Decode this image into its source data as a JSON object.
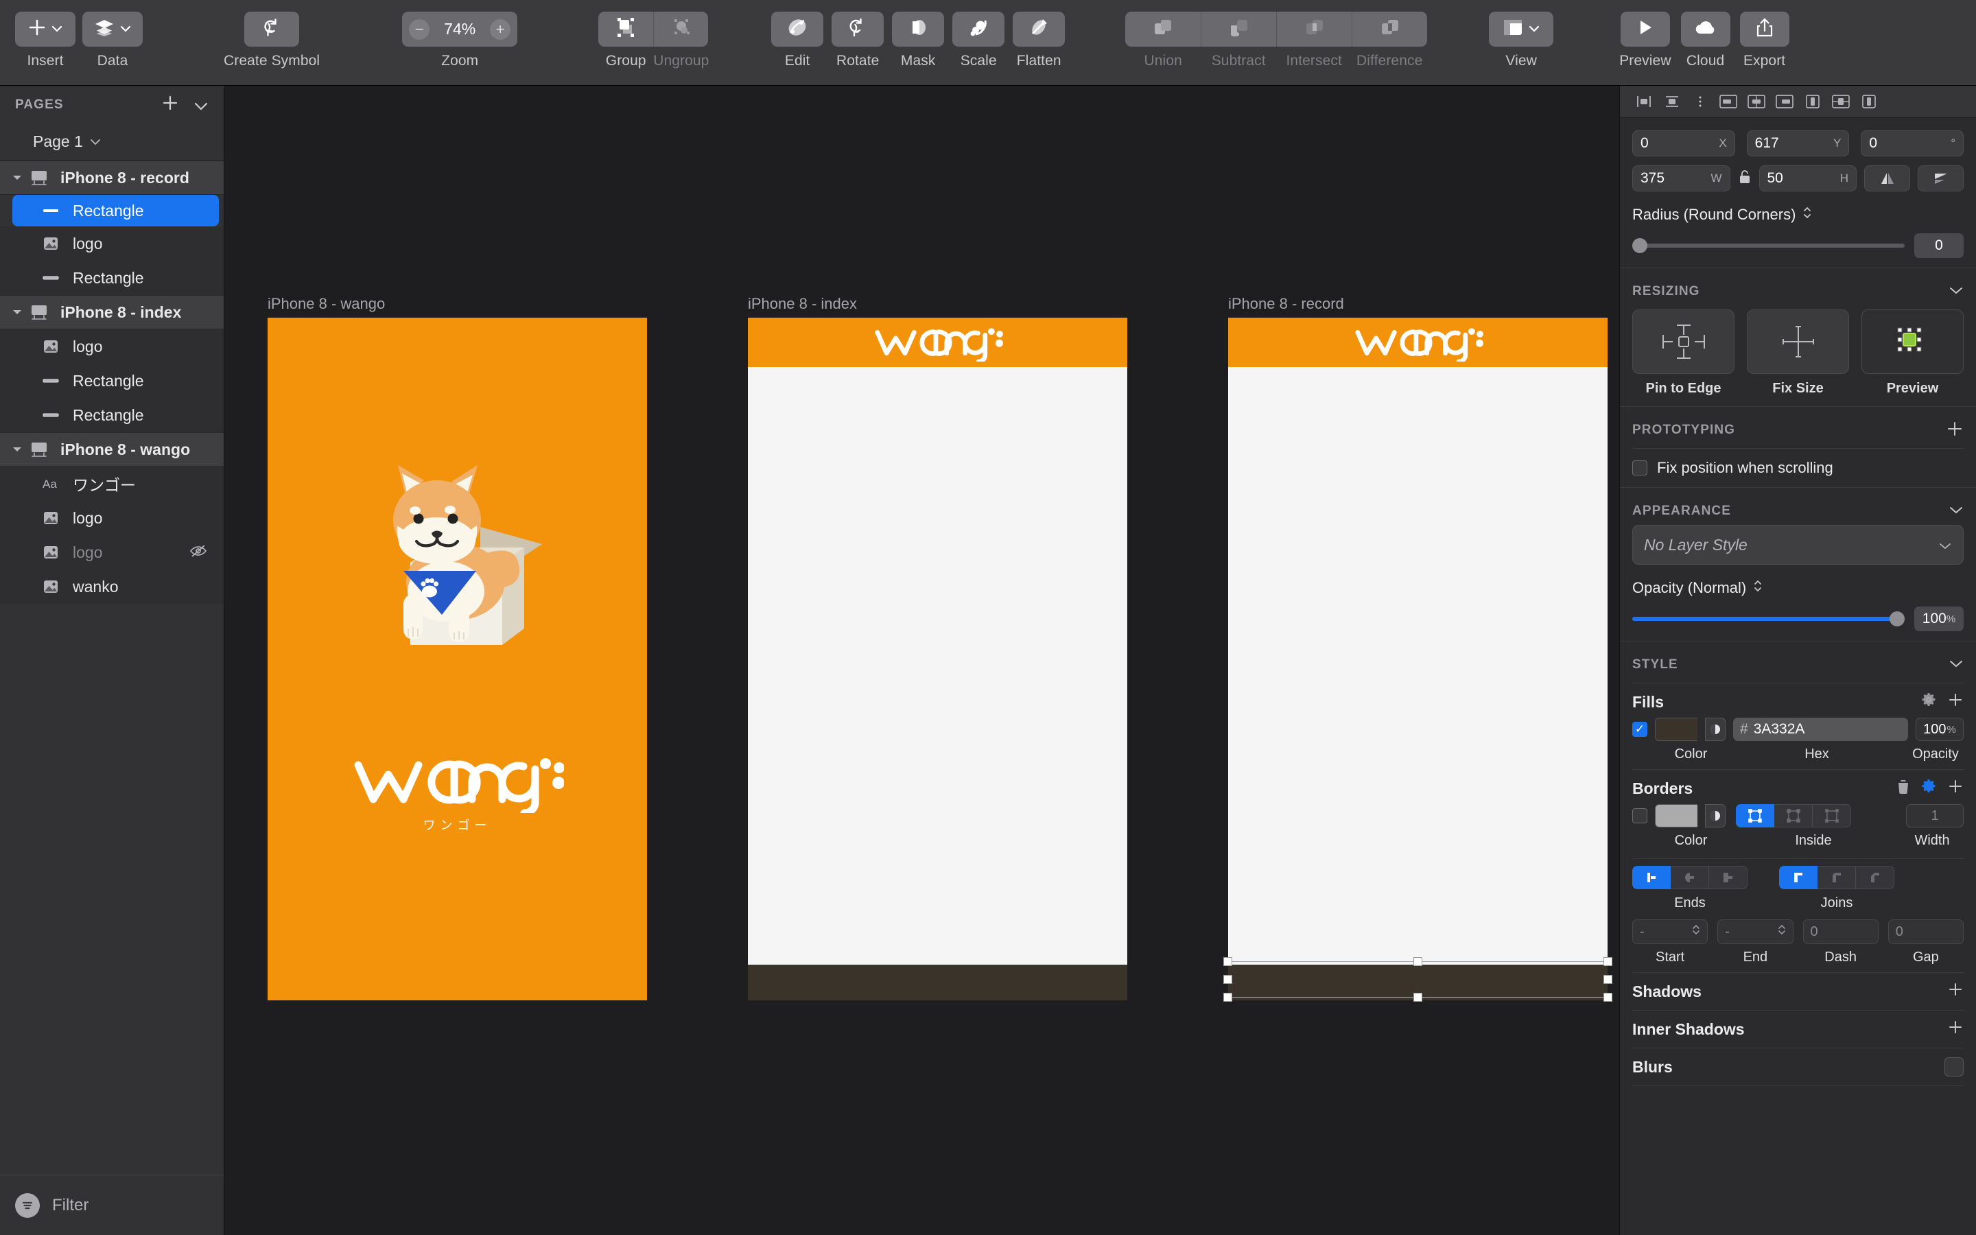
{
  "toolbar": {
    "groups": [
      {
        "items": [
          {
            "label": "Insert",
            "icon": "plus-icon",
            "dim": false
          },
          {
            "label": "Data",
            "icon": "layers-stack-icon",
            "dim": false
          }
        ]
      },
      {
        "items": [
          {
            "label": "Create Symbol",
            "icon": "create-symbol-icon",
            "dim": false
          }
        ]
      },
      {
        "items": [
          {
            "label": "Zoom",
            "icon": "zoom-control",
            "dim": false
          }
        ]
      },
      {
        "items": [
          {
            "label": "Group",
            "icon": "group-icon",
            "dim": false
          },
          {
            "label": "Ungroup",
            "icon": "ungroup-icon",
            "dim": true
          }
        ]
      },
      {
        "items": [
          {
            "label": "Edit",
            "icon": "edit-icon",
            "dim": false
          },
          {
            "label": "Rotate",
            "icon": "rotate-icon",
            "dim": false
          },
          {
            "label": "Mask",
            "icon": "mask-icon",
            "dim": false
          },
          {
            "label": "Scale",
            "icon": "scale-icon",
            "dim": false
          },
          {
            "label": "Flatten",
            "icon": "flatten-icon",
            "dim": false
          }
        ]
      },
      {
        "items": [
          {
            "label": "Union",
            "icon": "union-icon",
            "dim": true
          },
          {
            "label": "Subtract",
            "icon": "subtract-icon",
            "dim": true
          },
          {
            "label": "Intersect",
            "icon": "intersect-icon",
            "dim": true
          },
          {
            "label": "Difference",
            "icon": "difference-icon",
            "dim": true
          }
        ]
      },
      {
        "items": [
          {
            "label": "View",
            "icon": "view-panels-icon",
            "dim": false
          }
        ]
      },
      {
        "items": [
          {
            "label": "Preview",
            "icon": "play-icon",
            "dim": false
          },
          {
            "label": "Cloud",
            "icon": "cloud-icon",
            "dim": false
          },
          {
            "label": "Export",
            "icon": "share-export-icon",
            "dim": false
          }
        ]
      }
    ],
    "zoom_value": "74%",
    "zoom_label": "Zoom",
    "zoom_out": "−",
    "zoom_in": "+"
  },
  "left_panel": {
    "pages_header": "PAGES",
    "page_name": "Page 1",
    "filter_label": "Filter",
    "layers": [
      {
        "name": "iPhone 8 - record",
        "type": "artboard",
        "icon": "artboard-icon",
        "selected": false,
        "hidden": false
      },
      {
        "name": "Rectangle",
        "type": "shape",
        "icon": "rectangle-shape-icon",
        "selected": true,
        "hidden": false
      },
      {
        "name": "logo",
        "type": "image",
        "icon": "image-icon",
        "selected": false,
        "hidden": false
      },
      {
        "name": "Rectangle",
        "type": "shape",
        "icon": "rectangle-shape-icon",
        "selected": false,
        "hidden": false
      },
      {
        "name": "iPhone 8 - index",
        "type": "artboard",
        "icon": "artboard-icon",
        "selected": false,
        "hidden": false
      },
      {
        "name": "logo",
        "type": "image",
        "icon": "image-icon",
        "selected": false,
        "hidden": false
      },
      {
        "name": "Rectangle",
        "type": "shape",
        "icon": "rectangle-shape-icon",
        "selected": false,
        "hidden": false
      },
      {
        "name": "Rectangle",
        "type": "shape",
        "icon": "rectangle-shape-icon",
        "selected": false,
        "hidden": false
      },
      {
        "name": "iPhone 8 - wango",
        "type": "artboard",
        "icon": "artboard-icon",
        "selected": false,
        "hidden": false
      },
      {
        "name": "ワンゴー",
        "type": "text",
        "icon": "text-icon",
        "selected": false,
        "hidden": false
      },
      {
        "name": "logo",
        "type": "image",
        "icon": "image-icon",
        "selected": false,
        "hidden": false
      },
      {
        "name": "logo",
        "type": "image",
        "icon": "image-icon",
        "selected": false,
        "hidden": true
      },
      {
        "name": "wanko",
        "type": "image",
        "icon": "image-icon",
        "selected": false,
        "hidden": false
      }
    ]
  },
  "canvas": {
    "artboards": [
      {
        "title": "iPhone 8 - wango",
        "kind": "splash",
        "bg": "#F3930B"
      },
      {
        "title": "iPhone 8 - index",
        "kind": "page",
        "header_bg": "#F3930B",
        "body_bg": "#f5f5f5",
        "footer_bg": "#3A332A"
      },
      {
        "title": "iPhone 8 - record",
        "kind": "page",
        "header_bg": "#F3930B",
        "body_bg": "#f5f5f5",
        "footer_bg": "#3A332A",
        "selected": true
      }
    ],
    "logo_text": "wango",
    "logo_subtext": "ワンゴー"
  },
  "inspector": {
    "position": {
      "x": "0",
      "x_unit": "X",
      "y": "617",
      "y_unit": "Y",
      "rotation": "0",
      "rotation_unit": "°",
      "w": "375",
      "w_unit": "W",
      "h": "50",
      "h_unit": "H"
    },
    "radius": {
      "label": "Radius (Round Corners)",
      "value": "0"
    },
    "resizing": {
      "header": "RESIZING",
      "options": [
        {
          "label": "Pin to Edge",
          "icon": "pin-to-edge-icon"
        },
        {
          "label": "Fix Size",
          "icon": "fix-size-icon"
        },
        {
          "label": "Preview",
          "icon": "resize-preview-icon"
        }
      ]
    },
    "prototyping": {
      "header": "PROTOTYPING",
      "fix_position_label": "Fix position when scrolling",
      "fix_position_checked": false
    },
    "appearance": {
      "header": "APPEARANCE",
      "layer_style": "No Layer Style",
      "opacity_label": "Opacity (Normal)",
      "opacity_value": "100",
      "opacity_unit": "%"
    },
    "style": {
      "header": "STYLE",
      "fills": {
        "title": "Fills",
        "enabled": true,
        "hex": "3A332A",
        "hash": "#",
        "opacity": "100",
        "opacity_unit": "%",
        "color_label": "Color",
        "hex_label": "Hex",
        "opacity_label": "Opacity",
        "swatch_color": "#3A332A"
      },
      "borders": {
        "title": "Borders",
        "enabled": false,
        "color_label": "Color",
        "position_label": "Inside",
        "width_label": "Width",
        "width": "1",
        "swatch_color": "#ababab",
        "ends_label": "Ends",
        "joins_label": "Joins",
        "start_label": "Start",
        "end_label": "End",
        "dash_label": "Dash",
        "gap_label": "Gap",
        "start": "-",
        "end": "-",
        "dash": "0",
        "gap": "0"
      },
      "shadows": {
        "title": "Shadows"
      },
      "inner_shadows": {
        "title": "Inner Shadows"
      },
      "blurs": {
        "title": "Blurs"
      }
    }
  }
}
